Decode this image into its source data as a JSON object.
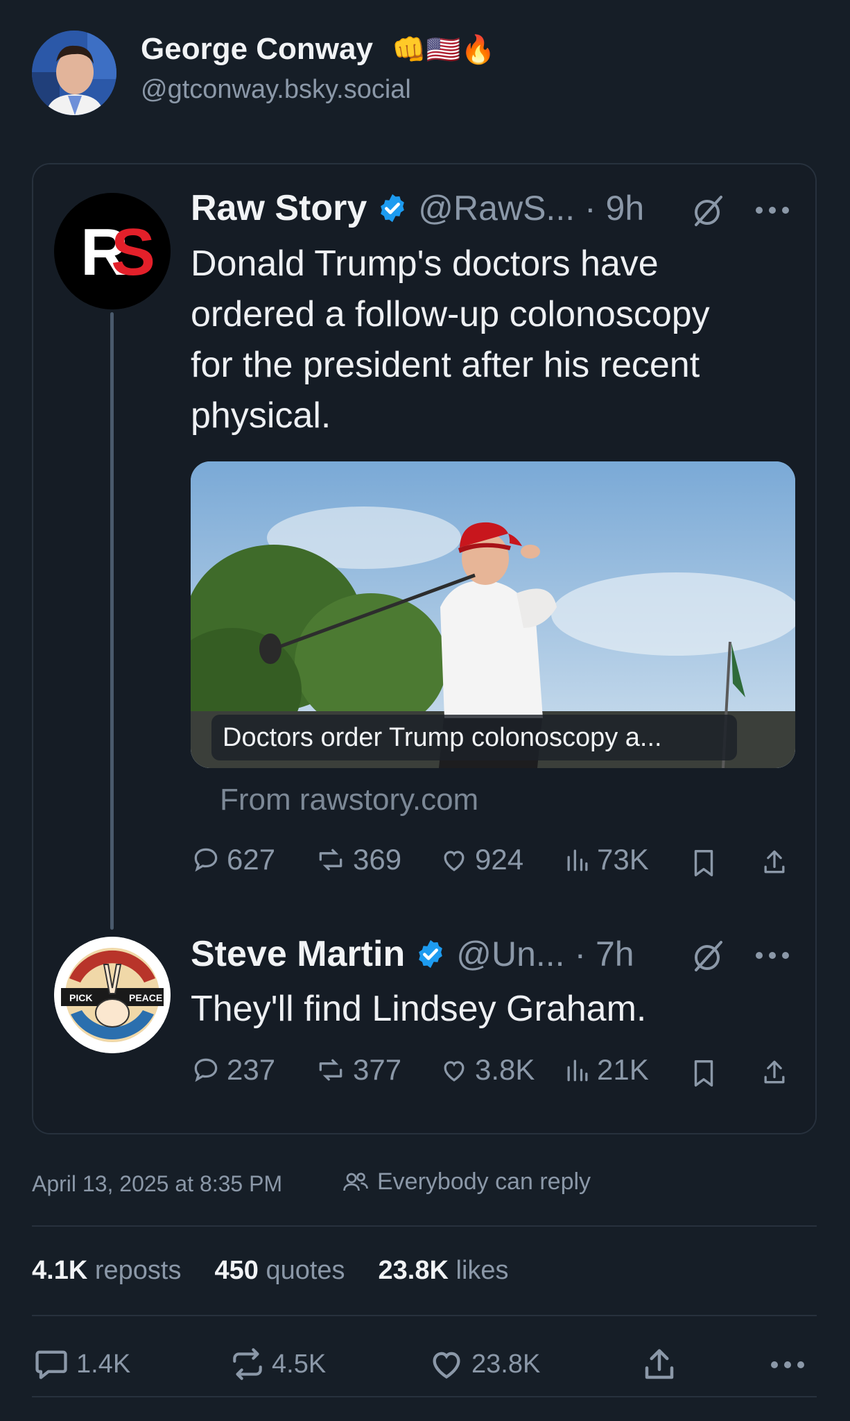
{
  "post": {
    "author_name": "George Conway",
    "author_emojis": "👊🇺🇸🔥",
    "author_handle": "@gtconway.bsky.social",
    "timestamp": "April 13, 2025 at 8:35 PM",
    "reply_permission": "Everybody can reply",
    "stats": {
      "reposts_count": "4.1K",
      "reposts_label": "reposts",
      "quotes_count": "450",
      "quotes_label": "quotes",
      "likes_count": "23.8K",
      "likes_label": "likes"
    },
    "actions": {
      "replies": "1.4K",
      "reposts": "4.5K",
      "likes": "23.8K"
    }
  },
  "embedded": {
    "tweet1": {
      "name": "Raw Story",
      "handle_time": "@RawS... · 9h",
      "avatar_text": "RS",
      "text_lines": [
        "Donald Trump's doctors have",
        "ordered a follow-up colonoscopy",
        "for the president after his recent",
        "physical."
      ],
      "link_caption": "Doctors order Trump colonoscopy a...",
      "link_source": "From rawstory.com",
      "replies": "627",
      "retweets": "369",
      "likes": "924",
      "views": "73K"
    },
    "tweet2": {
      "name": "Steve Martin",
      "handle_time": "@Un... · 7h",
      "avatar_left": "PICK",
      "avatar_right": "PEACE",
      "text": "They'll find Lindsey Graham.",
      "replies": "237",
      "retweets": "377",
      "likes": "3.8K",
      "views": "21K"
    }
  },
  "colors": {
    "background": "#161e27",
    "text": "#f1f3f5",
    "muted": "#8b98a8",
    "verified": "#1d9bf0",
    "border": "#27313d"
  }
}
